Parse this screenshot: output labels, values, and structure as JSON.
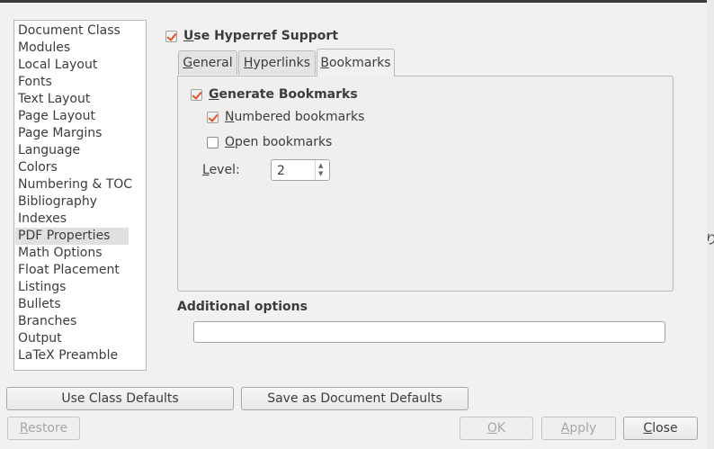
{
  "sidebar": {
    "items": [
      {
        "label": "Document Class"
      },
      {
        "label": "Modules"
      },
      {
        "label": "Local Layout"
      },
      {
        "label": "Fonts"
      },
      {
        "label": "Text Layout"
      },
      {
        "label": "Page Layout"
      },
      {
        "label": "Page Margins"
      },
      {
        "label": "Language"
      },
      {
        "label": "Colors"
      },
      {
        "label": "Numbering & TOC"
      },
      {
        "label": "Bibliography"
      },
      {
        "label": "Indexes"
      },
      {
        "label": "PDF Properties"
      },
      {
        "label": "Math Options"
      },
      {
        "label": "Float Placement"
      },
      {
        "label": "Listings"
      },
      {
        "label": "Bullets"
      },
      {
        "label": "Branches"
      },
      {
        "label": "Output"
      },
      {
        "label": "LaTeX Preamble"
      }
    ],
    "selected": "PDF Properties"
  },
  "hyperref": {
    "first": "U",
    "rest": "se Hyperref Support",
    "checked": true
  },
  "tabs": [
    {
      "first": "G",
      "rest": "eneral"
    },
    {
      "first": "H",
      "rest": "yperlinks"
    },
    {
      "first": "B",
      "rest": "ookmarks"
    }
  ],
  "active_tab": "Bookmarks",
  "bookmarks": {
    "generate": {
      "first": "G",
      "rest": "enerate Bookmarks",
      "checked": true
    },
    "numbered": {
      "first": "N",
      "rest": "umbered bookmarks",
      "checked": true
    },
    "open": {
      "first": "O",
      "rest": "pen bookmarks",
      "checked": false
    },
    "level": {
      "first": "L",
      "rest": "evel:",
      "value": "2"
    }
  },
  "additional_options": {
    "label": "Additional options",
    "value": ""
  },
  "buttons": {
    "use_class_defaults": "Use Class Defaults",
    "save_doc_defaults": "Save as Document Defaults",
    "restore": {
      "first": "R",
      "rest": "estore"
    },
    "ok": {
      "first": "O",
      "rest": "K"
    },
    "apply": {
      "first": "A",
      "rest": "pply"
    },
    "close": {
      "first": "C",
      "rest": "lose"
    }
  },
  "stray_glyph": "り"
}
